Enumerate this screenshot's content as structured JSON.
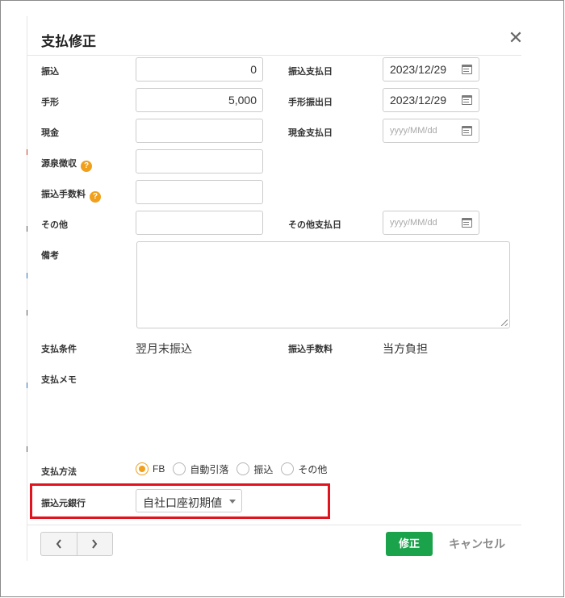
{
  "dialog": {
    "title": "支払修正",
    "close_symbol": "✕"
  },
  "fields": {
    "transfer": {
      "label": "振込",
      "value": "0"
    },
    "transfer_date": {
      "label": "振込支払日",
      "value": "2023/12/29"
    },
    "bill": {
      "label": "手形",
      "value": "5,000"
    },
    "bill_date": {
      "label": "手形振出日",
      "value": "2023/12/29"
    },
    "cash": {
      "label": "現金",
      "value": ""
    },
    "cash_date": {
      "label": "現金支払日",
      "placeholder": "yyyy/MM/dd"
    },
    "withholding": {
      "label": "源泉徴収",
      "help": "?",
      "value": ""
    },
    "transfer_fee": {
      "label": "振込手数料",
      "help": "?",
      "value": ""
    },
    "other": {
      "label": "その他",
      "value": ""
    },
    "other_date": {
      "label": "その他支払日",
      "placeholder": "yyyy/MM/dd"
    },
    "remarks": {
      "label": "備考",
      "value": ""
    }
  },
  "info": {
    "payment_terms": {
      "label": "支払条件",
      "value": "翌月末振込"
    },
    "fee_bearer": {
      "label": "振込手数料",
      "value": "当方負担"
    },
    "payment_memo": {
      "label": "支払メモ",
      "value": ""
    }
  },
  "payment_method": {
    "label": "支払方法",
    "options": [
      {
        "label": "FB",
        "checked": true
      },
      {
        "label": "自動引落",
        "checked": false
      },
      {
        "label": "振込",
        "checked": false
      },
      {
        "label": "その他",
        "checked": false
      }
    ]
  },
  "source_bank": {
    "label": "振込元銀行",
    "selected": "自社口座初期値"
  },
  "footer": {
    "prev_icon": "chevron-left-icon",
    "next_icon": "chevron-right-icon",
    "submit_label": "修正",
    "cancel_label": "キャンセル"
  },
  "colors": {
    "accent_orange": "#f0a01c",
    "submit_green": "#1aa34a",
    "highlight_red": "#e0141e"
  }
}
